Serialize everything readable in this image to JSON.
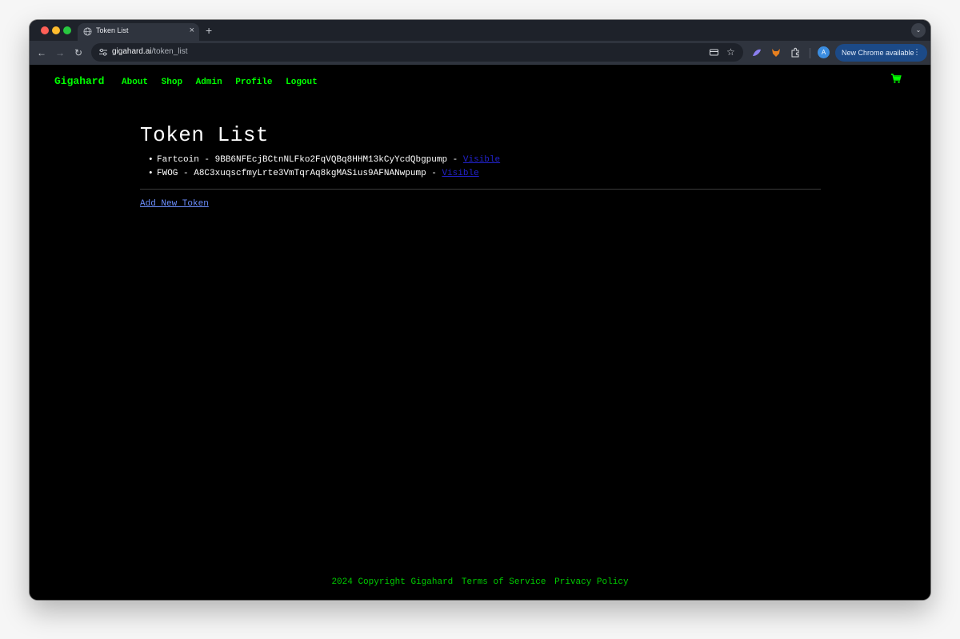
{
  "browser": {
    "tab_title": "Token List",
    "new_tab_label": "+",
    "url_host": "gigahard.ai",
    "url_path": "/token_list",
    "profile_initial": "A",
    "update_label": "New Chrome available"
  },
  "nav": {
    "brand": "Gigahard",
    "links": [
      "About",
      "Shop",
      "Admin",
      "Profile",
      "Logout"
    ]
  },
  "page": {
    "title": "Token List",
    "tokens": [
      {
        "name": "Fartcoin",
        "address": "9BB6NFEcjBCtnNLFko2FqVQBq8HHM13kCyYcdQbgpump",
        "status": "Visible"
      },
      {
        "name": "FWOG",
        "address": "A8C3xuqscfmyLrte3VmTqrAq8kgMASius9AFNANwpump",
        "status": "Visible"
      }
    ],
    "add_label": "Add New Token"
  },
  "footer": {
    "copyright": "2024 Copyright Gigahard",
    "terms": "Terms of Service",
    "privacy": "Privacy Policy"
  },
  "icons": {
    "tab_favicon": "globe-icon",
    "site_info": "tune-icon",
    "cart": "cart-icon"
  },
  "colors": {
    "nav_green": "#00ff00",
    "footer_green": "#00cc00",
    "link_blue": "#6b8dfb",
    "status_link": "#2222cc"
  }
}
